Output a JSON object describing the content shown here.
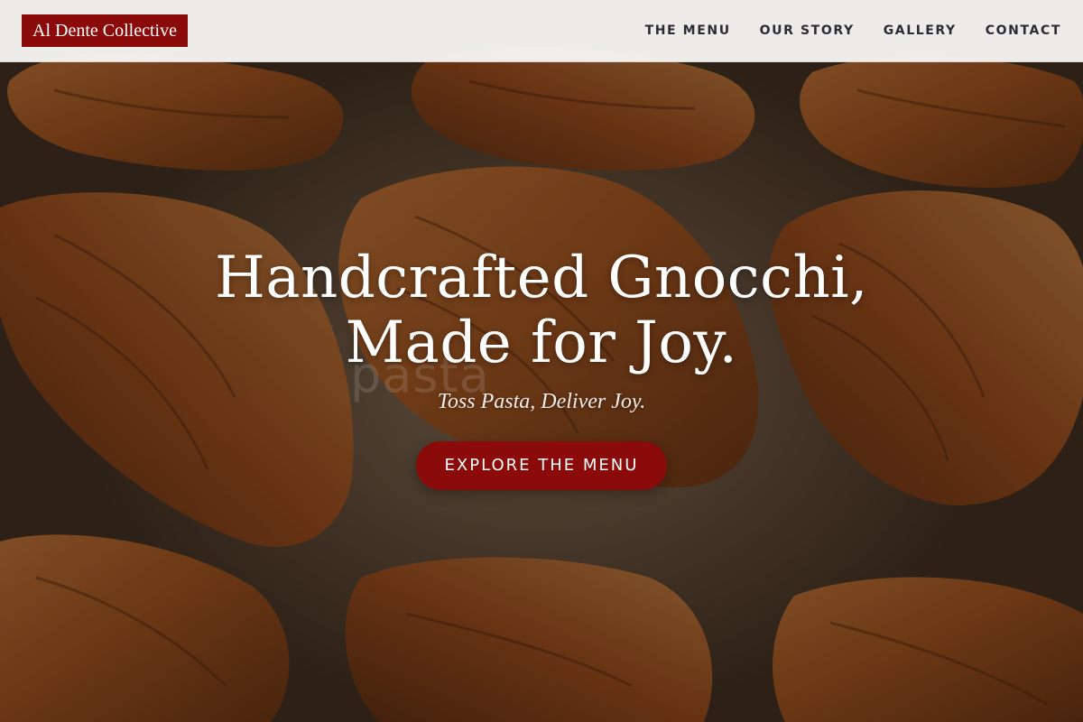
{
  "brand": {
    "logo_text": "Al Dente Collective",
    "accent_color": "#8b0a0a"
  },
  "nav": {
    "items": [
      {
        "label": "THE MENU"
      },
      {
        "label": "OUR STORY"
      },
      {
        "label": "GALLERY"
      },
      {
        "label": "CONTACT"
      }
    ]
  },
  "hero": {
    "headline_line1": "Handcrafted Gnocchi,",
    "headline_line2": "Made for Joy.",
    "tagline": "Toss Pasta, Deliver Joy.",
    "cta_label": "EXPLORE THE MENU",
    "watermark_text": "pasta",
    "background_image": "croissants-on-baking-sheet"
  }
}
